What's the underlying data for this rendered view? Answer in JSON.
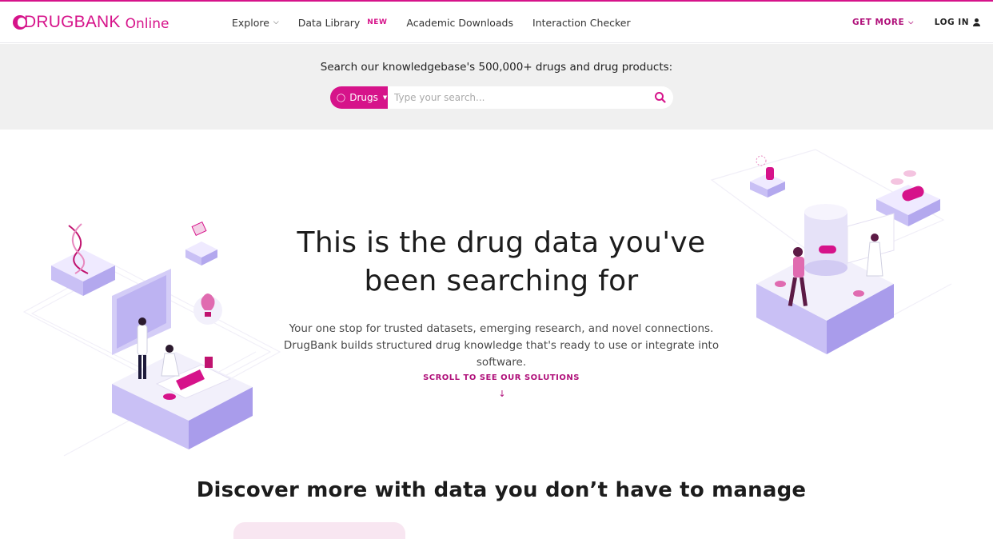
{
  "brand": {
    "logo_text": "DRUGBANK",
    "logo_suffix": "Online",
    "accent": "#d6138a"
  },
  "nav": {
    "explore": "Explore",
    "data_library": "Data Library",
    "data_library_badge": "NEW",
    "academic": "Academic Downloads",
    "interaction": "Interaction Checker",
    "get_more": "GET MORE",
    "login": "LOG IN"
  },
  "search": {
    "title": "Search our knowledgebase's 500,000+ drugs and drug products:",
    "category": "Drugs",
    "placeholder": "Type your search..."
  },
  "hero": {
    "title": "This is the drug data you've been searching for",
    "subtitle": "Your one stop for trusted datasets, emerging research, and novel connections. DrugBank builds structured drug knowledge that's ready to use or integrate into software.",
    "scroll_cta": "SCROLL TO SEE OUR SOLUTIONS",
    "scroll_arrow": "↓"
  },
  "discover": {
    "title": "Discover more with data you don’t have to manage"
  },
  "icons": {
    "chevron": "chevron-down-icon",
    "pill": "pill-icon",
    "search": "search-icon",
    "user": "user-icon"
  }
}
